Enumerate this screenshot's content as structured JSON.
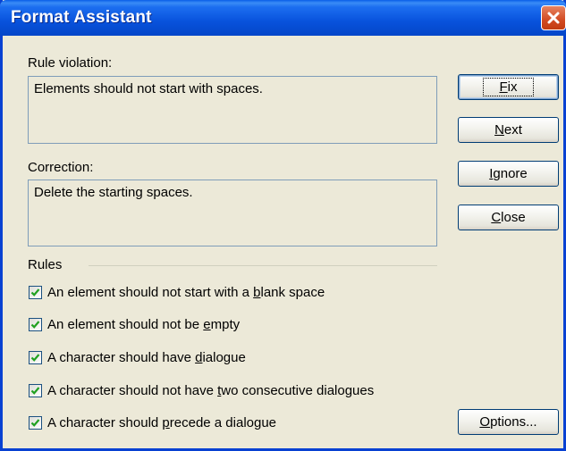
{
  "window": {
    "title": "Format Assistant"
  },
  "rule_violation": {
    "label": "Rule violation:",
    "value": "Elements should not start with spaces."
  },
  "correction": {
    "label": "Correction:",
    "value": "Delete the starting spaces."
  },
  "buttons": {
    "fix": {
      "pre": "",
      "key": "F",
      "post": "ix"
    },
    "next": {
      "pre": "",
      "key": "N",
      "post": "ext"
    },
    "ignore": {
      "pre": "",
      "key": "I",
      "post": "gnore"
    },
    "close": {
      "pre": "",
      "key": "C",
      "post": "lose"
    },
    "options": {
      "pre": "",
      "key": "O",
      "post": "ptions..."
    }
  },
  "rules": {
    "label": "Rules",
    "items": [
      {
        "pre": "An element should not start with a ",
        "key": "b",
        "post": "lank space",
        "checked": true
      },
      {
        "pre": "An element should not be ",
        "key": "e",
        "post": "mpty",
        "checked": true
      },
      {
        "pre": "A character should have ",
        "key": "d",
        "post": "ialogue",
        "checked": true
      },
      {
        "pre": "A character should not have ",
        "key": "t",
        "post": "wo consecutive dialogues",
        "checked": true
      },
      {
        "pre": "A character should ",
        "key": "p",
        "post": "recede a dialogue",
        "checked": true
      }
    ]
  },
  "colors": {
    "title_bar": "#0852dc",
    "window_bg": "#ece9d8",
    "close_button": "#d24a22",
    "check_mark": "#21a121"
  },
  "icons": {
    "close": "close-x-icon",
    "checkbox": "check-mark-icon"
  }
}
